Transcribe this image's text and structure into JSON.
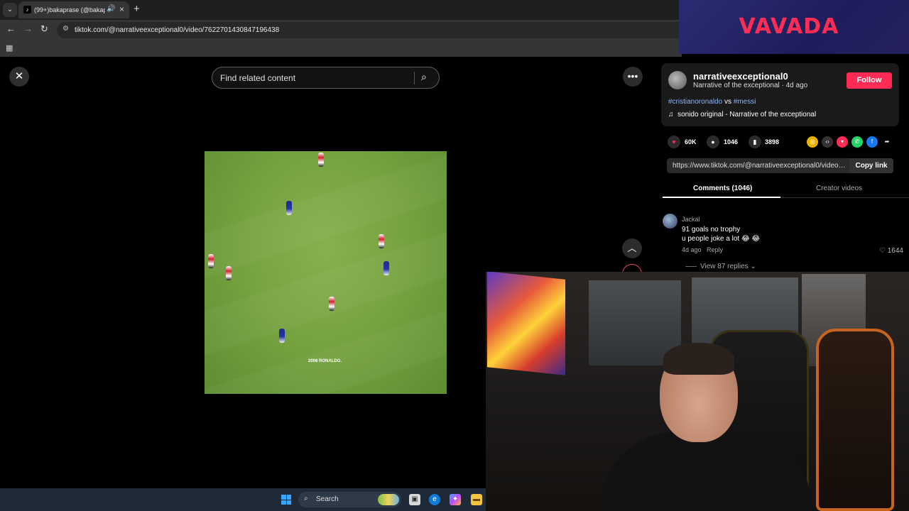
{
  "browser": {
    "tab_title": "(99+)bakaprase (@bakapra",
    "url": "tiktok.com/@narrativeexceptional0/video/7622701430847196438",
    "icons": [
      "tab-menu-icon",
      "tiktok-favicon-icon",
      "speaker-icon",
      "close-icon",
      "plus-icon",
      "back-icon",
      "forward-icon",
      "reload-icon",
      "site-info-icon",
      "apps-grid-icon"
    ]
  },
  "overlay_ad": {
    "brand": "VAVADA",
    "brand_color": "#ff2d55"
  },
  "search": {
    "placeholder": "Find related content"
  },
  "video": {
    "caption": "2008 RONALDO."
  },
  "post": {
    "username": "narrativeexceptional0",
    "author_line": "Narrative of the exceptional · 4d ago",
    "follow_label": "Follow",
    "hashtag1": "#cristianoronaldo",
    "connector": " vs ",
    "hashtag2": "#messi",
    "music": "sonido original - Narrative of the exceptional",
    "likes": "60K",
    "comments_count": "1046",
    "saves": "3898",
    "link": "https://www.tiktok.com/@narrativeexceptional0/video/...",
    "copy_label": "Copy link"
  },
  "tabs": {
    "comments": "Comments (1046)",
    "creator": "Creator videos"
  },
  "comment": {
    "user": "Jackal",
    "line1": "91 goals no trophy",
    "line2": "u people joke a lot 😂 😂",
    "time": "4d ago",
    "reply_label": "Reply",
    "likes": "1644",
    "view_replies": "View 87 replies"
  },
  "taskbar": {
    "search_label": "Search"
  },
  "colors": {
    "accent": "#fe2c55",
    "hashtag": "#8ab4f8",
    "panel": "#1a1a1a"
  }
}
